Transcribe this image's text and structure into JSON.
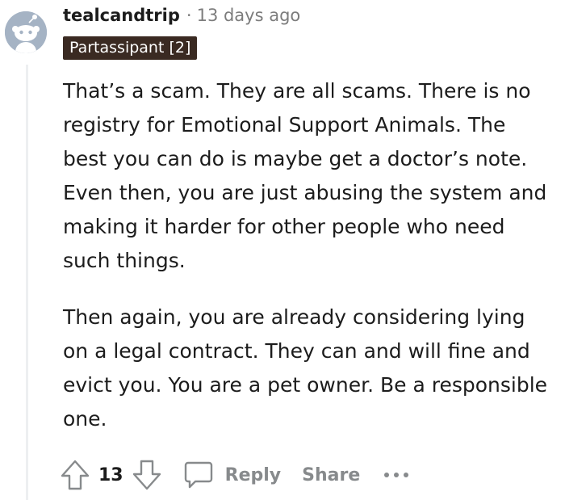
{
  "comment": {
    "username": "tealcandtrip",
    "separator": "·",
    "timestamp": "13 days ago",
    "flair": "Partassipant [2]",
    "paragraphs": [
      "That’s a scam. They are all scams. There is no registry for Emotional Support Animals. The best you can do is maybe get a doctor’s note. Even then, you are just abusing the system and making it harder for other people who need such things.",
      "Then again, you are already considering lying on a legal contract. They can and will fine and evict you. You are a pet owner. Be a responsible one."
    ]
  },
  "actions": {
    "upvote_icon": "upvote-arrow-icon",
    "vote_count": "13",
    "downvote_icon": "downvote-arrow-icon",
    "reply_icon": "speech-bubble-icon",
    "reply_label": "Reply",
    "share_label": "Share",
    "more_icon": "ellipsis-icon"
  },
  "colors": {
    "flair_bg": "#3a2a22",
    "meta_text": "#7c7c7c",
    "action_text": "#878a8c",
    "avatar_bg": "#a5b3c4"
  }
}
